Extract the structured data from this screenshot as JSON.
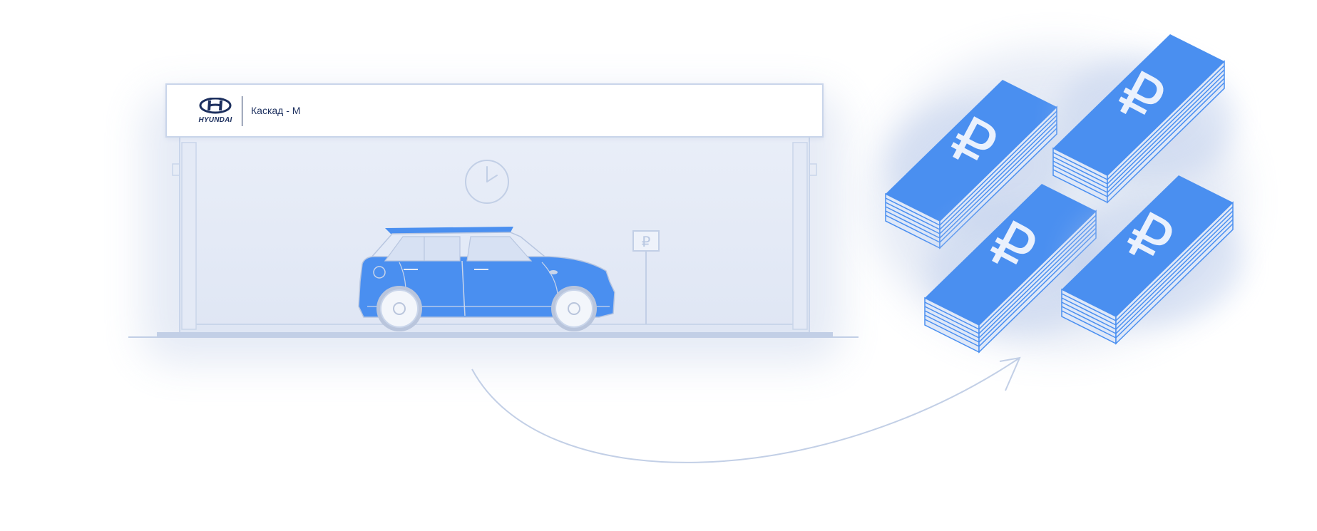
{
  "dealer": {
    "brand_name": "HYUNDAI",
    "name": "Каскад - М"
  },
  "scene": {
    "parking_sign_symbol": "₽",
    "currency_symbol": "₽",
    "money_stack_count": 4
  },
  "icons": {
    "clock": "clock-icon",
    "parking": "parking-sign-icon",
    "car": "car-illustration",
    "money": "ruble-money-stack",
    "arrow": "curved-arrow"
  },
  "colors": {
    "car_blue": "#4a8ff0",
    "money_blue": "#4a8ff0",
    "outline": "#b8c6e0",
    "brand_navy": "#1c2f5e"
  }
}
